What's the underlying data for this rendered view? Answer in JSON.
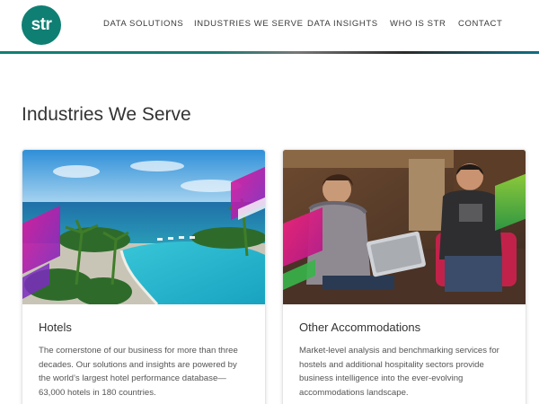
{
  "brand": {
    "logo_text": "str",
    "accent": "#0f7f73"
  },
  "nav": {
    "items": [
      "DATA SOLUTIONS",
      "INDUSTRIES WE SERVE",
      "DATA INSIGHTS",
      "WHO IS STR",
      "CONTACT"
    ]
  },
  "page": {
    "title": "Industries We Serve"
  },
  "cards": [
    {
      "title": "Hotels",
      "text": "The cornerstone of our business for more than three decades. Our solutions and insights are powered by the world’s largest hotel performance database—63,000 hotels in 180 countries.",
      "image": "resort-pool-ocean-photo"
    },
    {
      "title": "Other Accommodations",
      "text": "Market-level analysis and benchmarking services for hostels and additional hospitality sectors provide business intelligence into the ever-evolving accommodations landscape.",
      "image": "hostel-lounge-people-photo"
    }
  ],
  "colors": {
    "magenta": "#c2188a",
    "purple": "#7b2cbf",
    "green": "#4cbb3a"
  }
}
